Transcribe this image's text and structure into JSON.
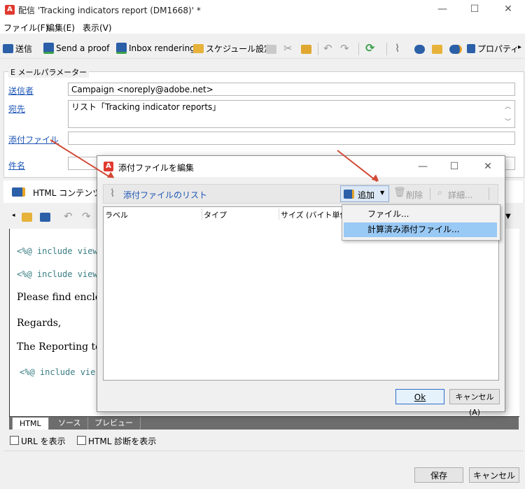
{
  "window": {
    "title": "配信 'Tracking indicators report (DM1668)' *",
    "minimize_glyph": "—",
    "maximize_glyph": "☐",
    "close_glyph": "✕"
  },
  "menu": [
    "ファイル(F)",
    "編集(E)",
    "表示(V)"
  ],
  "toolbar": {
    "send": "送信",
    "send_proof": "Send a proof",
    "inbox_rendering": "Inbox rendering",
    "schedule": "スケジュール設定",
    "properties": "プロパティ"
  },
  "email_params": {
    "legend": "E メールパラメーター",
    "sender_label": "送信者",
    "sender_value": "Campaign <noreply@adobe.net>",
    "to_label": "宛先",
    "to_value": "リスト「Tracking indicator reports」",
    "attachment_label": "添付ファイル",
    "subject_label": "件名"
  },
  "content": {
    "tab_label": "HTML コンテンツ",
    "lines": [
      "<%@ include view",
      "<%@ include view",
      "Please find enclos",
      "Regards,",
      "The Reporting tea",
      "<%@ include vie"
    ],
    "bottom_tabs": [
      "HTML",
      "ソース",
      "プレビュー"
    ],
    "show_url": "URL を表示",
    "show_html_diag": "HTML 診断を表示"
  },
  "footer": {
    "save": "保存",
    "cancel": "キャンセル"
  },
  "dialog": {
    "title": "添付ファイルを編集",
    "list_label": "添付ファイルのリスト",
    "add": "追加",
    "delete": "削除",
    "details": "詳細...",
    "columns": [
      "ラベル",
      "タイプ",
      "サイズ (バイト単位)"
    ],
    "ok": "Ok",
    "cancel": "キャンセル(A)"
  },
  "dropdown": {
    "items": [
      "ファイル...",
      "計算済み添付ファイル..."
    ]
  },
  "colors": {
    "accent": "#e03a2f",
    "link": "#1c55b5",
    "highlight": "#99c9f5",
    "arrow": "#d24a36"
  }
}
